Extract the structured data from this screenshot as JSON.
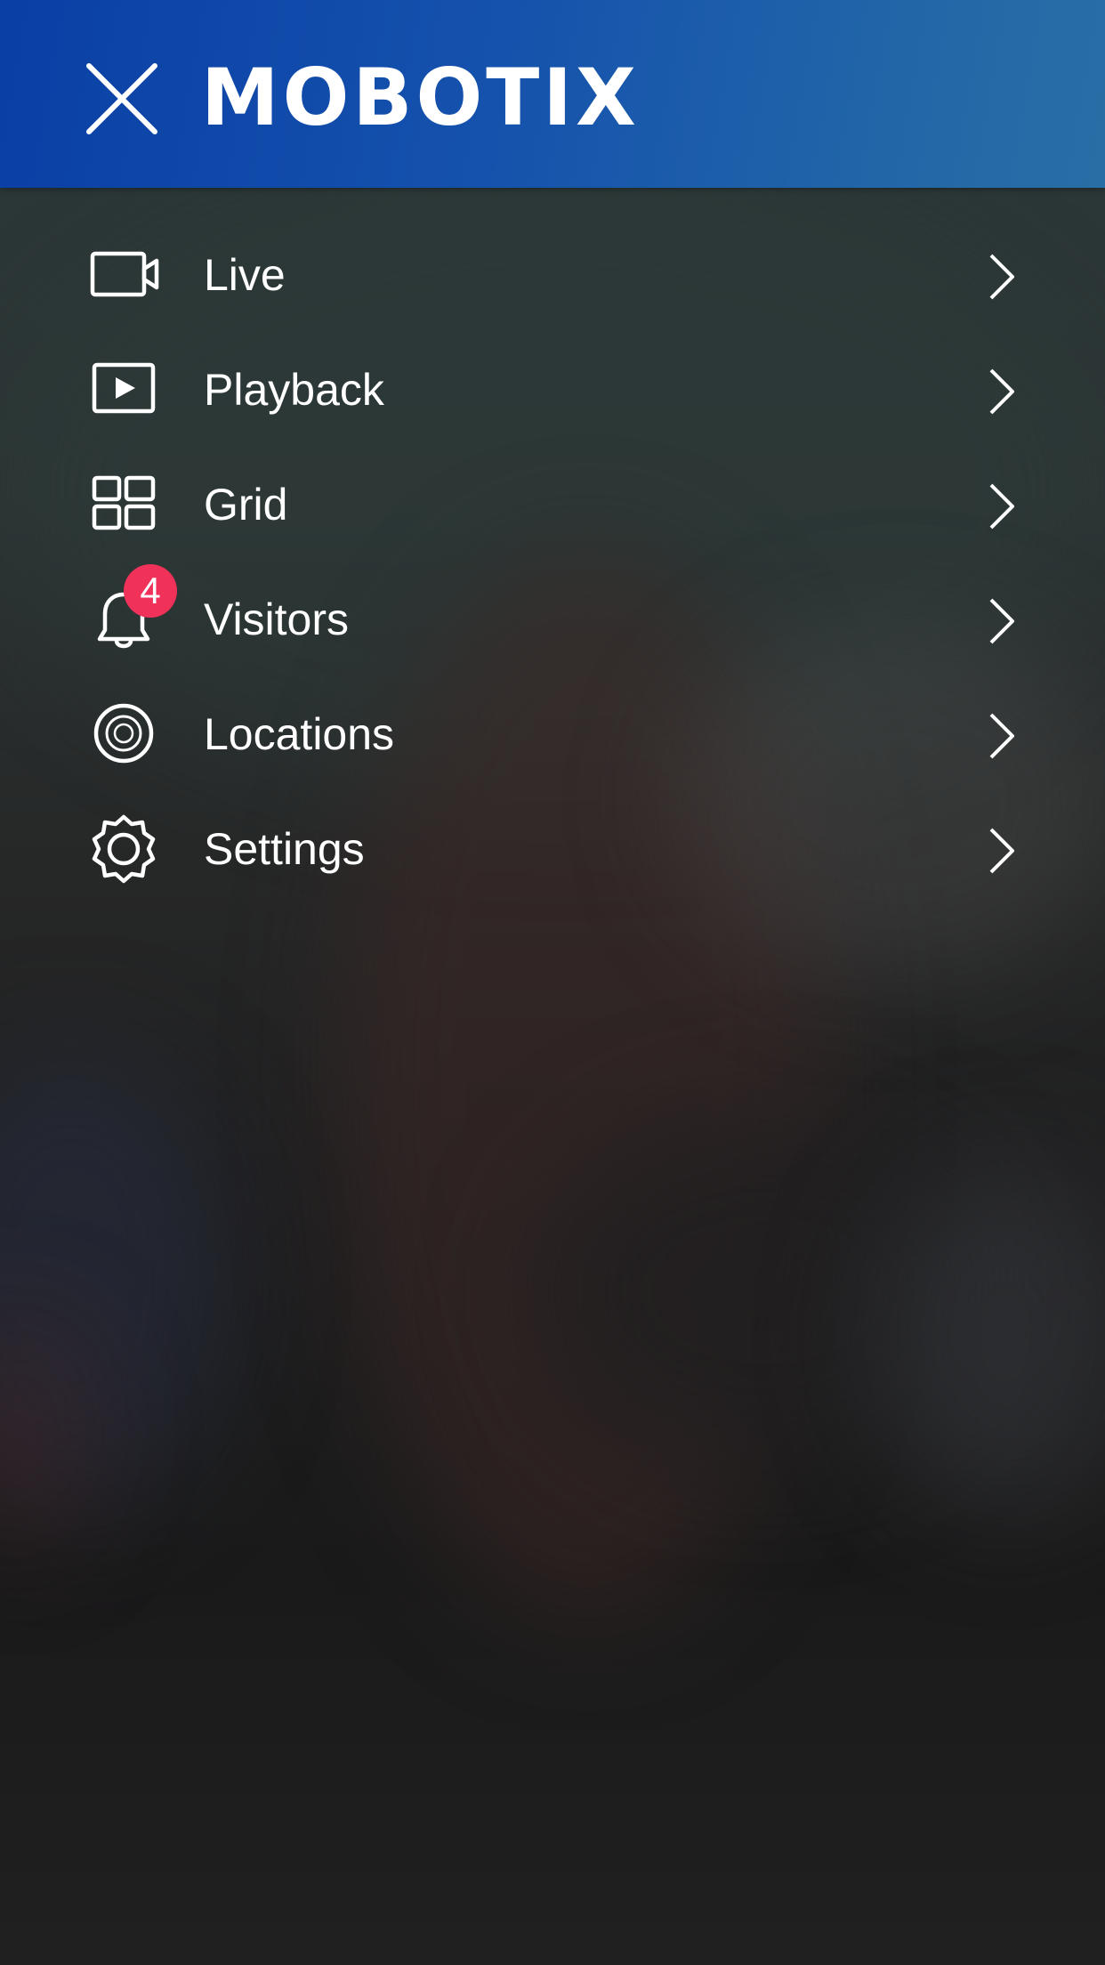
{
  "header": {
    "brand": "MOBOTIX",
    "close_icon": "close-icon",
    "color": "#0a3fa5"
  },
  "menu": {
    "items": [
      {
        "label": "Live",
        "icon": "video-camera-icon"
      },
      {
        "label": "Playback",
        "icon": "play-icon"
      },
      {
        "label": "Grid",
        "icon": "grid-icon"
      },
      {
        "label": "Visitors",
        "icon": "bell-icon",
        "badge": "4"
      },
      {
        "label": "Locations",
        "icon": "target-icon"
      },
      {
        "label": "Settings",
        "icon": "gear-icon"
      }
    ],
    "chevron_icon": "chevron-right-icon"
  },
  "colors": {
    "badge": "#f0315a",
    "text": "#ffffff"
  }
}
